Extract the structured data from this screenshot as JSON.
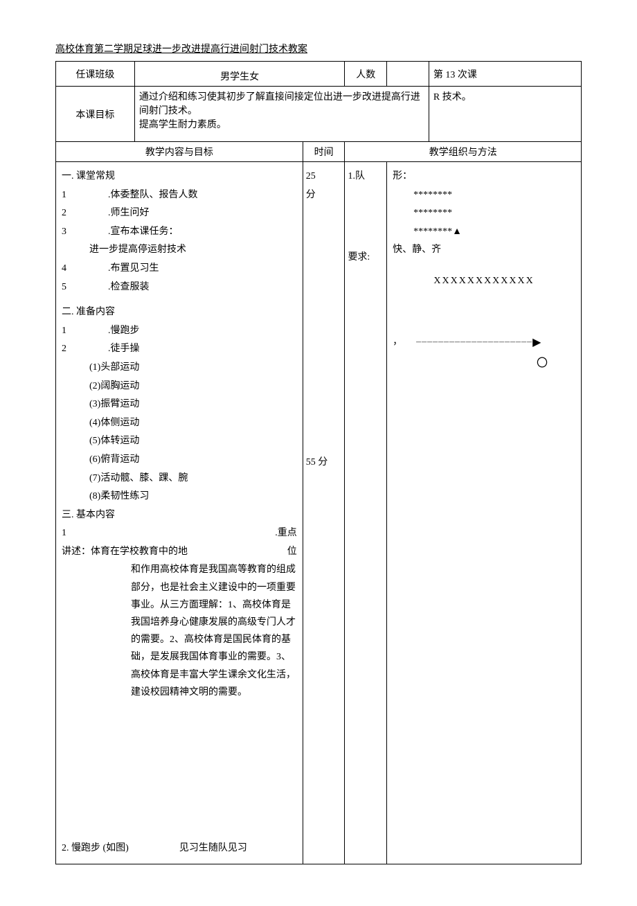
{
  "title": "高校体育第二学期足球进一步改进提高行进间射门技术教案",
  "header": {
    "class_label": "任课班级",
    "class_value": "男学生女",
    "count_label": "人数",
    "lesson_no": "第 13 次课"
  },
  "goal": {
    "label": "本课目标",
    "line1": "通过介绍和练习使其初步了解直接间接定位出进一步改进提高行进间射门技术。",
    "line2": "提高学生耐力素质。",
    "right_note": "R 技术。"
  },
  "columns": {
    "content_label": "教学内容与目标",
    "time_label": "时间",
    "org_label": "教学组织与方法"
  },
  "content": {
    "section1_title": "一. 课堂常规",
    "item1_num": "1",
    "item1": ".体委整队、报告人数",
    "item2_num": "2",
    "item2": ".师生问好",
    "item3_num": "3",
    "item3": ".宣布本课任务：",
    "item3_sub": "进一步提高停运射技术",
    "item4_num": "4",
    "item4": ".布置见习生",
    "item5_num": "5",
    "item5": ".检查服装",
    "section2_title": "二. 准备内容",
    "prep1_num": "1",
    "prep1": ".慢跑步",
    "prep2_num": "2",
    "prep2": ".徒手操",
    "ex1": "(1)头部运动",
    "ex2": "(2)阔胸运动",
    "ex3": "(3)振臂运动",
    "ex4": "(4)体侧运动",
    "ex5": "(5)体转运动",
    "ex6": "(6)俯背运动",
    "ex7": "(7)活动髋、膝、踝、腕",
    "ex8": "(8)柔韧性练习",
    "section3_title": "三. 基本内容",
    "basic1_num": "1",
    "basic1_right": ".重点",
    "lecture_label": "讲述：体育在学校教育中的地",
    "lecture_right": "位",
    "lecture_para": "和作用高校体育是我国高等教育的组成部分，也是社会主义建设中的一项重要事业。从三方面理解：1、高校体育是我国培养身心健康发展的高级专门人才的需要。2、高校体育是国民体育的基础，是发展我国体育事业的需要。3、高校体育是丰富大学生课余文化生活，建设校园精神文明的需要。",
    "bottom_left": "2. 慢跑步 (如图)",
    "bottom_right": "见习生随队见习"
  },
  "time": {
    "t1": "25",
    "t1_unit": "分",
    "t2": "55 分"
  },
  "org": {
    "label1": "1.队",
    "label2": "要求:",
    "formation": "形：",
    "stars1": "********",
    "stars2": "********",
    "stars3": "********▲",
    "req": "快、静、齐",
    "xline": "XXXXXXXXXXXX",
    "dashes": "–––––––––––––––––––––",
    "arrow": "▶",
    "comma": "，",
    "circle": "〇"
  }
}
